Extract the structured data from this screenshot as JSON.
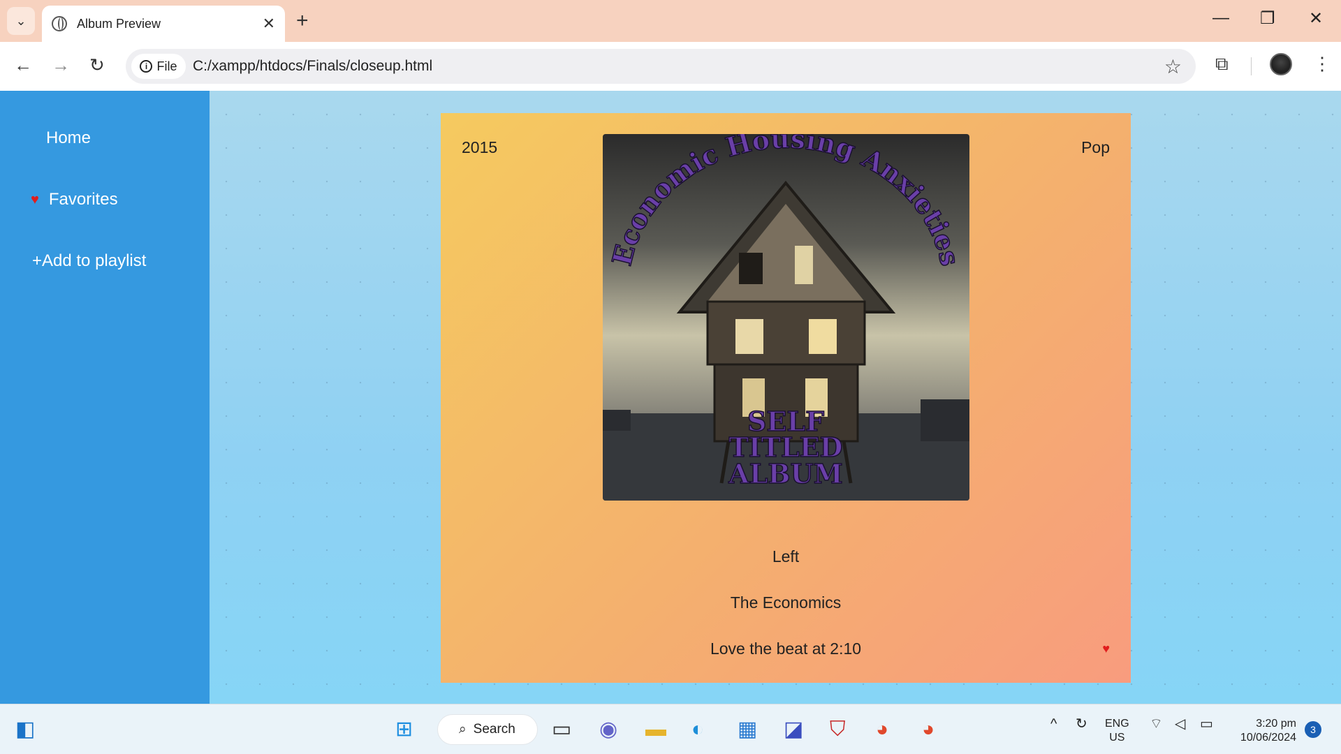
{
  "browser": {
    "tab_title": "Album Preview",
    "tab_close": "✕",
    "new_tab": "+",
    "window_minimize": "—",
    "window_restore": "❐",
    "window_close": "✕",
    "chip_label": "File",
    "url": "C:/xampp/htdocs/Finals/closeup.html"
  },
  "sidebar": {
    "items": [
      {
        "label": "Home"
      },
      {
        "label": "Favorites"
      },
      {
        "label": "+Add to playlist"
      }
    ]
  },
  "album": {
    "year": "2015",
    "genre": "Pop",
    "cover_title_top": "Economic Housing Anxieties",
    "cover_title_bottom_1": "SELF",
    "cover_title_bottom_2": "TITLED",
    "cover_title_bottom_3": "ALBUM",
    "song": "Left",
    "artist": "The Economics",
    "note": "Love the beat at 2:10",
    "favorite_icon": "♥"
  },
  "taskbar": {
    "search_label": "Search",
    "lang_1": "ENG",
    "lang_2": "US",
    "time": "3:20 pm",
    "date": "10/06/2024",
    "notification_count": "3"
  },
  "colors": {
    "sidebar": "#3599e0",
    "card_start": "#f5ca5f",
    "card_end": "#f89c7e",
    "heart": "#e11d1d"
  }
}
